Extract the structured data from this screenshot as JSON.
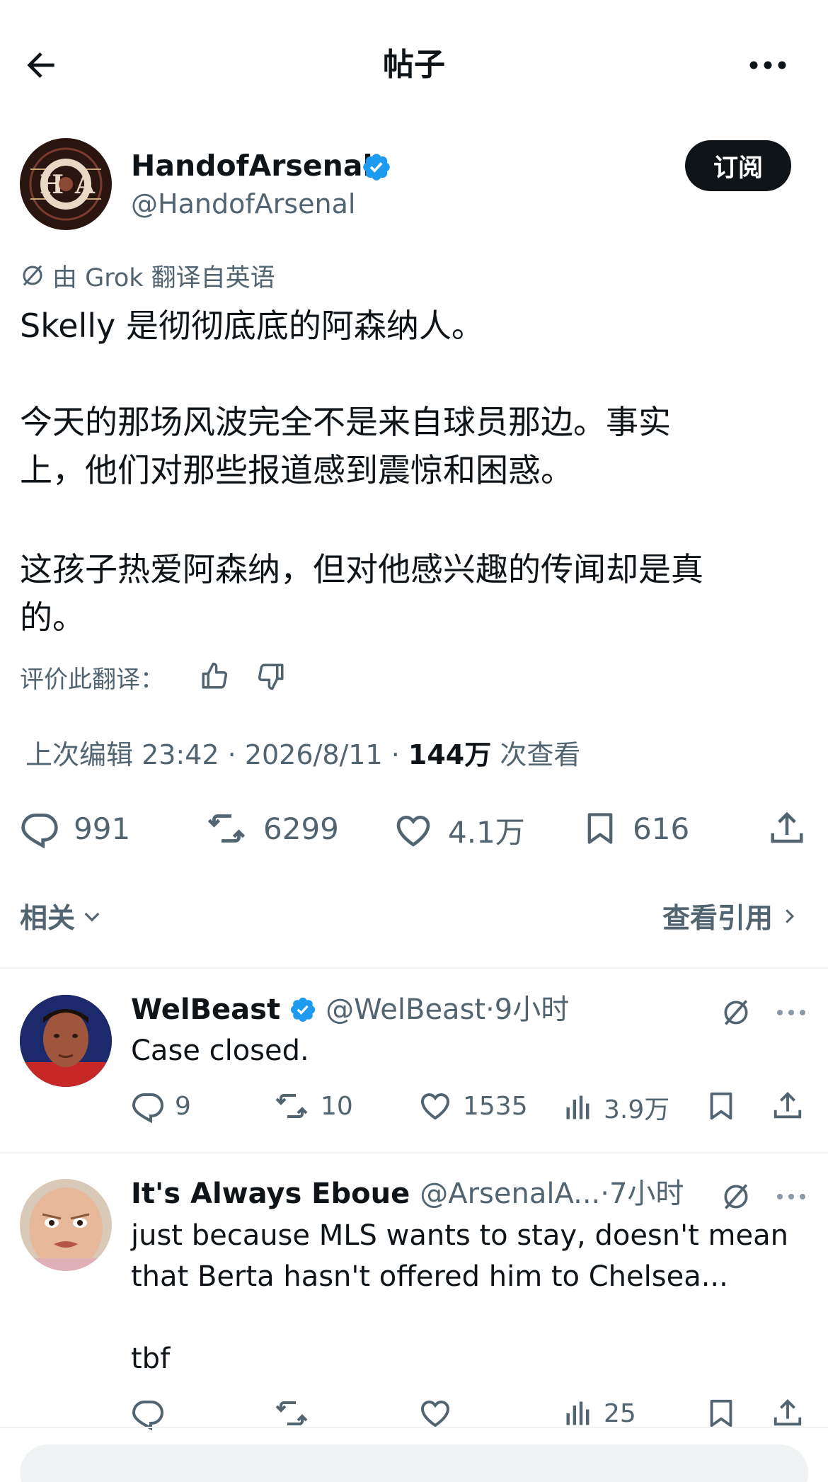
{
  "header": {
    "title": "帖子",
    "back_icon": "arrow-left-icon",
    "more_icon": "more-horizontal-icon"
  },
  "author": {
    "name": "HandofArsenal",
    "handle": "@HandofArsenal",
    "verified_color": "#1d9bf0",
    "avatar_text": "H⊙A",
    "subscribe_label": "订阅"
  },
  "translation": {
    "note": "由 Grok 翻译自英语",
    "rate_label": "评价此翻译："
  },
  "post": {
    "lines": [
      "Skelly 是彻彻底底的阿森纳人。",
      "今天的那场风波完全不是来自球员那边。事实",
      "上，他们对那些报道感到震惊和困惑。",
      "这孩子热爱阿森纳，但对他感兴趣的传闻却是真",
      "的。"
    ]
  },
  "meta": {
    "edited": "上次编辑 23:42 · 2026/8/11 · ",
    "views_count": "144万",
    "views_label": " 次查看"
  },
  "actions": {
    "replies": "991",
    "reposts": "6299",
    "likes": "4.1万",
    "bookmarks": "616"
  },
  "related": {
    "label": "相关",
    "view_quotes": "查看引用"
  },
  "replies": [
    {
      "name": "WelBeast",
      "handle": "@WelBeast",
      "time": "·9小时",
      "verified": true,
      "text_lines": [
        "Case closed."
      ],
      "replies": "9",
      "reposts": "10",
      "likes": "1535",
      "views": "3.9万"
    },
    {
      "name": "It's Always Eboue",
      "handle": "@ArsenalA...",
      "time": "·7小时",
      "verified": false,
      "text_lines": [
        "just because MLS wants to stay, doesn't mean",
        "that Berta hasn't offered him to Chelsea...",
        "tbf"
      ],
      "replies": "",
      "reposts": "",
      "likes": "",
      "views": "25"
    }
  ],
  "colors": {
    "text": "#0f1419",
    "muted": "#536471",
    "accent": "#1d9bf0",
    "divider": "#eff3f4"
  }
}
